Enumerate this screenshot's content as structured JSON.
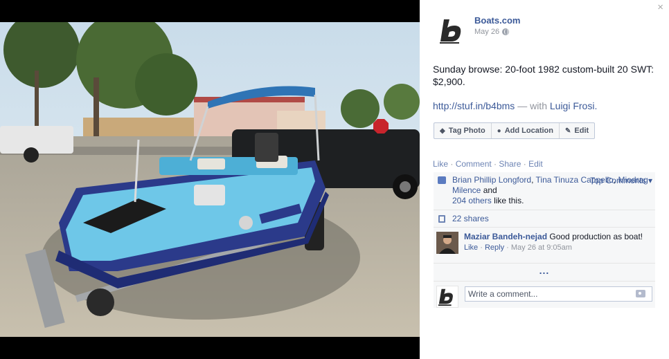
{
  "photo": {
    "alt_subject": ""
  },
  "post": {
    "page_name": "Boats.com",
    "date": "May 26",
    "text": "Sunday browse: 20-foot 1982 custom-built 20 SWT: $2,900.",
    "link": "http://stuf.in/b4bms",
    "with_prefix": "— with",
    "with_name": "Luigi Frosi."
  },
  "photo_buttons": {
    "tag": "Tag Photo",
    "location": "Add Location",
    "edit": "Edit"
  },
  "actions": {
    "like": "Like",
    "comment": "Comment",
    "share": "Share",
    "edit": "Edit",
    "sep": " · "
  },
  "likes": {
    "name1": "Brian Phillip Longford",
    "name2": "Tina Tinuza Cappello",
    "name3": "Miodrag Milence",
    "and": "and",
    "others": "204 others",
    "suffix": "like this.",
    "top_comments": "Top Comments ▾"
  },
  "shares": {
    "label": "22 shares"
  },
  "comment": {
    "author": "Maziar Bandeh-nejad",
    "text": "Good production as boat!",
    "like": "Like",
    "reply": "Reply",
    "time": "May 26 at 9:05am"
  },
  "more": {
    "label": "..."
  },
  "write": {
    "placeholder": "Write a comment..."
  },
  "colors": {
    "link": "#3b5998",
    "canopy": "#2f74b5",
    "hull": "#2c3a8c"
  },
  "icons": [
    "close-icon",
    "globe-icon",
    "tag-icon",
    "location-pin-icon",
    "pencil-icon",
    "like-icon",
    "share-icon",
    "camera-icon"
  ]
}
